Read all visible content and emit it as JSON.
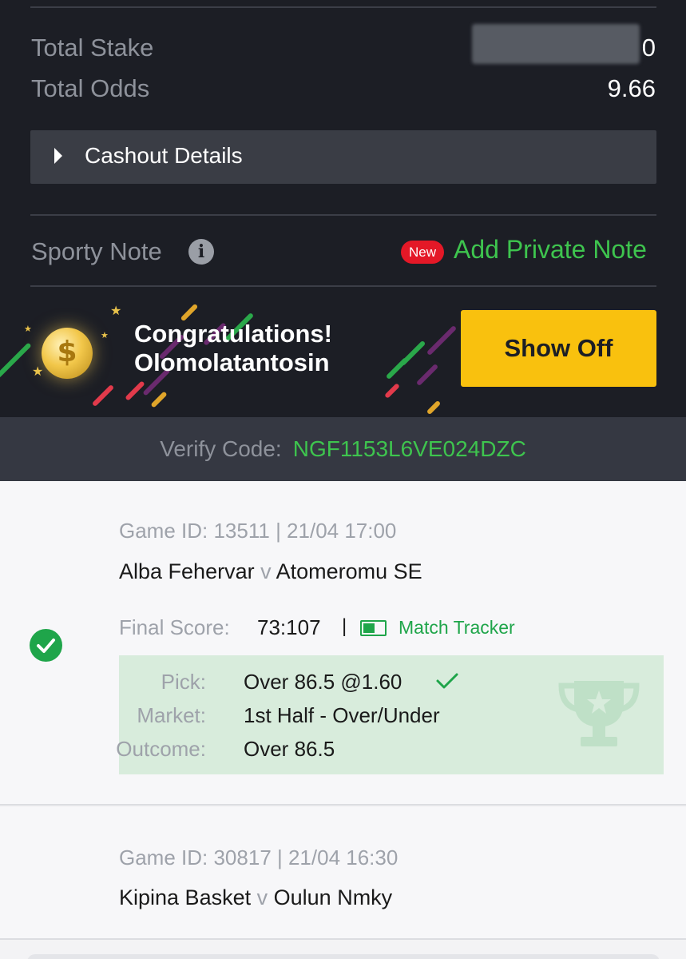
{
  "summary": {
    "total_stake_label": "Total Stake",
    "total_stake_value": "0",
    "total_odds_label": "Total Odds",
    "total_odds_value": "9.66"
  },
  "cashout": {
    "label": "Cashout Details"
  },
  "note": {
    "label": "Sporty Note",
    "badge": "New",
    "action": "Add Private Note"
  },
  "banner": {
    "line1": "Congratulations!",
    "line2": "Olomolatantosin",
    "coin_symbol": "$",
    "button": "Show Off"
  },
  "verify": {
    "label": "Verify Code:",
    "code": "NGF1153L6VE024DZC"
  },
  "bets": [
    {
      "game_id": "Game ID: 13511 | 21/04 17:00",
      "home": "Alba Fehervar",
      "vs": "v",
      "away": "Atomeromu SE",
      "status": "won",
      "final_score_label": "Final Score:",
      "final_score": "73:107",
      "separator": "|",
      "tracker_label": "Match Tracker",
      "pick_label": "Pick:",
      "pick_value": "Over 86.5 @1.60",
      "market_label": "Market:",
      "market_value": "1st Half - Over/Under",
      "outcome_label": "Outcome:",
      "outcome_value": "Over 86.5"
    },
    {
      "game_id": "Game ID: 30817 | 21/04 16:30",
      "home": "Kipina Basket",
      "vs": "v",
      "away": "Oulun Nmky"
    }
  ],
  "colors": {
    "dark_bg": "#1c1e25",
    "accent_green": "#3ec44e",
    "win_green": "#1fa54a",
    "button_yellow": "#f9c10e",
    "badge_red": "#e41827"
  },
  "icons": [
    "caret-right-icon",
    "info-icon",
    "coin-icon",
    "check-circle-icon",
    "check-icon",
    "match-tracker-icon",
    "trophy-icon"
  ]
}
